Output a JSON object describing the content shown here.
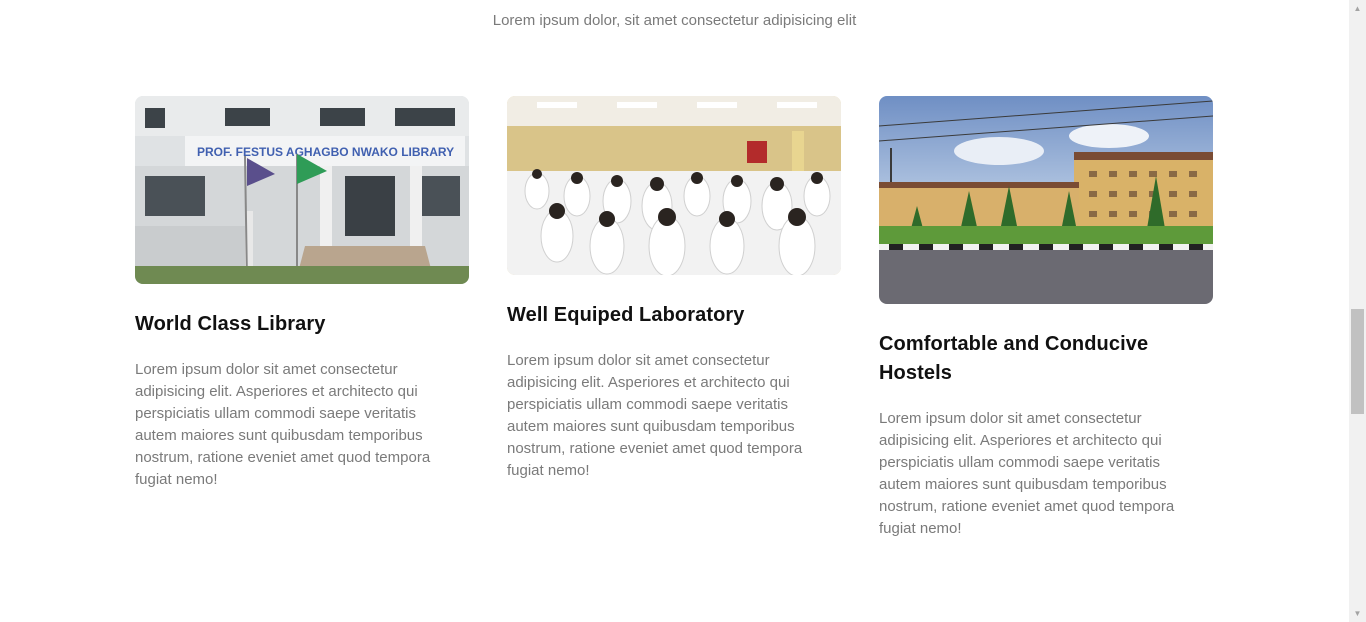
{
  "section": {
    "subtitle": "Lorem ipsum dolor, sit amet consectetur adipisicing elit"
  },
  "cards": [
    {
      "image_alt": "library-building-photo",
      "image_sign": "PROF. FESTUS AGHAGBO NWAKO LIBRARY",
      "title": "World Class Library",
      "text": "Lorem ipsum dolor sit amet consectetur adipisicing elit. Asperiores et architecto qui perspiciatis ullam commodi saepe veritatis autem maiores sunt quibusdam temporibus nostrum, ratione eveniet amet quod tempora fugiat nemo!"
    },
    {
      "image_alt": "laboratory-photo",
      "title": "Well Equiped Laboratory",
      "text": "Lorem ipsum dolor sit amet consectetur adipisicing elit. Asperiores et architecto qui perspiciatis ullam commodi saepe veritatis autem maiores sunt quibusdam temporibus nostrum, ratione eveniet amet quod tempora fugiat nemo!"
    },
    {
      "image_alt": "hostels-photo",
      "title": "Comfortable and Conducive Hostels",
      "text": "Lorem ipsum dolor sit amet consectetur adipisicing elit. Asperiores et architecto qui perspiciatis ullam commodi saepe veritatis autem maiores sunt quibusdam temporibus nostrum, ratione eveniet amet quod tempora fugiat nemo!"
    }
  ],
  "scrollbar": {
    "up_icon": "triangle-up-icon",
    "down_icon": "triangle-down-icon"
  },
  "colors": {
    "heading": "#111111",
    "body_text": "#7a7a7a",
    "background": "#ffffff"
  }
}
